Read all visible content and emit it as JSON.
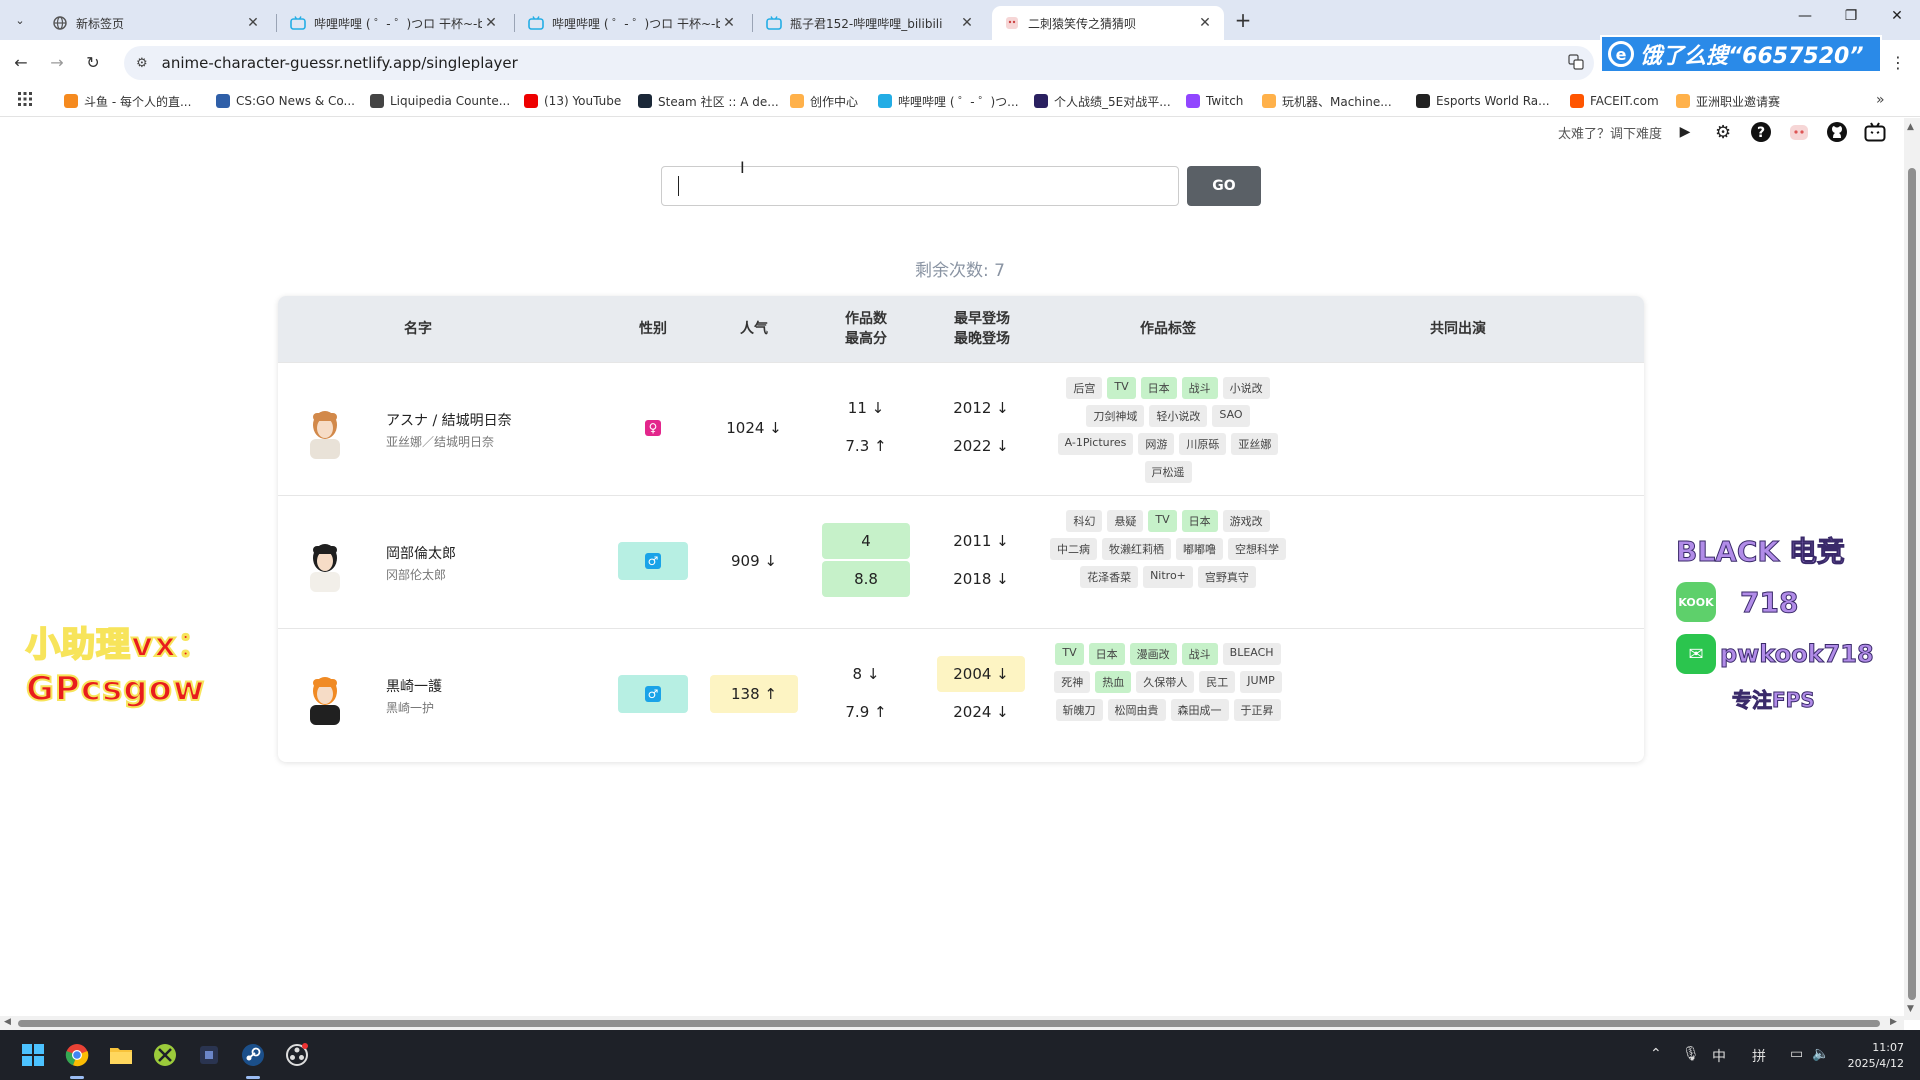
{
  "browser": {
    "tabs": [
      {
        "title": "新标签页",
        "active": false
      },
      {
        "title": "哔哩哔哩 ( ゜- ゜)つロ 干杯~-bili",
        "active": false
      },
      {
        "title": "哔哩哔哩 ( ゜- ゜)つロ 干杯~-bili",
        "active": false
      },
      {
        "title": "瓶子君152-哔哩哔哩_bilibili",
        "active": false
      },
      {
        "title": "二刺猿笑传之猜猜呗",
        "active": true
      }
    ],
    "url": "anime-character-guessr.netlify.app/singleplayer",
    "promo_text": "饿了么搜“6657520”",
    "bookmarks": [
      {
        "label": "斗鱼 - 每个人的直...",
        "color": "#f58a1f"
      },
      {
        "label": "CS:GO News & Co...",
        "color": "#2f5fa8"
      },
      {
        "label": "Liquipedia Counte...",
        "color": "#444"
      },
      {
        "label": "(13) YouTube",
        "color": "#e00"
      },
      {
        "label": "Steam 社区 :: A de...",
        "color": "#1b2838"
      },
      {
        "label": "创作中心",
        "color": "#ffb14a"
      },
      {
        "label": "哔哩哔哩 ( ゜- ゜)つ...",
        "color": "#23ade5"
      },
      {
        "label": "个人战绩_5E对战平...",
        "color": "#2a2060"
      },
      {
        "label": "Twitch",
        "color": "#9146ff"
      },
      {
        "label": "玩机器、Machine...",
        "color": "#ffb14a"
      },
      {
        "label": "Esports World Ra...",
        "color": "#222"
      },
      {
        "label": "FACEIT.com",
        "color": "#ff5500"
      },
      {
        "label": "亚洲职业邀请赛",
        "color": "#ffb14a"
      }
    ]
  },
  "game": {
    "difficulty_hint": "太难了？调下难度",
    "input_placeholder": "",
    "go_label": "GO",
    "remaining_label": "剩余次数: 7",
    "headers": {
      "name": "名字",
      "gender": "性别",
      "popularity": "人气",
      "works_count": "作品数",
      "highest_score": "最高分",
      "earliest": "最早登场",
      "latest": "最晚登场",
      "tags": "作品标签",
      "shared": "共同出演"
    },
    "rows": [
      {
        "name": "アスナ / 結城明日奈",
        "name_cn": "亚丝娜／结城明日奈",
        "gender": "female",
        "gender_match": false,
        "popularity": "1024 ↓",
        "popularity_hl": "",
        "works": "11 ↓",
        "works_hl": "",
        "score": "7.3 ↑",
        "score_hl": "",
        "earliest": "2012 ↓",
        "earliest_hl": "",
        "latest": "2022 ↓",
        "latest_hl": "",
        "tags": [
          {
            "t": "后宫",
            "m": false
          },
          {
            "t": "TV",
            "m": true
          },
          {
            "t": "日本",
            "m": true
          },
          {
            "t": "战斗",
            "m": true
          },
          {
            "t": "小说改",
            "m": false
          },
          {
            "t": "刀剑神域",
            "m": false
          },
          {
            "t": "轻小说改",
            "m": false
          },
          {
            "t": "SAO",
            "m": false
          },
          {
            "t": "A-1Pictures",
            "m": false
          },
          {
            "t": "网游",
            "m": false
          },
          {
            "t": "川原砾",
            "m": false
          },
          {
            "t": "亚丝娜",
            "m": false
          },
          {
            "t": "戸松遥",
            "m": false
          }
        ]
      },
      {
        "name": "岡部倫太郎",
        "name_cn": "冈部伦太郎",
        "gender": "male",
        "gender_match": true,
        "popularity": "909 ↓",
        "popularity_hl": "",
        "works": "4",
        "works_hl": "green",
        "score": "8.8",
        "score_hl": "green",
        "earliest": "2011 ↓",
        "earliest_hl": "",
        "latest": "2018 ↓",
        "latest_hl": "",
        "tags": [
          {
            "t": "科幻",
            "m": false
          },
          {
            "t": "悬疑",
            "m": false
          },
          {
            "t": "TV",
            "m": true
          },
          {
            "t": "日本",
            "m": true
          },
          {
            "t": "游戏改",
            "m": false
          },
          {
            "t": "中二病",
            "m": false
          },
          {
            "t": "牧濑红莉栖",
            "m": false
          },
          {
            "t": "嘟嘟噜",
            "m": false
          },
          {
            "t": "空想科学",
            "m": false
          },
          {
            "t": "花泽香菜",
            "m": false
          },
          {
            "t": "Nitro+",
            "m": false
          },
          {
            "t": "宫野真守",
            "m": false
          }
        ]
      },
      {
        "name": "黒崎一護",
        "name_cn": "黑崎一护",
        "gender": "male",
        "gender_match": true,
        "popularity": "138 ↑",
        "popularity_hl": "yellow",
        "works": "8 ↓",
        "works_hl": "",
        "score": "7.9 ↑",
        "score_hl": "",
        "earliest": "2004 ↓",
        "earliest_hl": "yellow",
        "latest": "2024 ↓",
        "latest_hl": "",
        "tags": [
          {
            "t": "TV",
            "m": true
          },
          {
            "t": "日本",
            "m": true
          },
          {
            "t": "漫画改",
            "m": true
          },
          {
            "t": "战斗",
            "m": true
          },
          {
            "t": "BLEACH",
            "m": false
          },
          {
            "t": "死神",
            "m": false
          },
          {
            "t": "热血",
            "m": true
          },
          {
            "t": "久保带人",
            "m": false
          },
          {
            "t": "民工",
            "m": false
          },
          {
            "t": "JUMP",
            "m": false
          },
          {
            "t": "斩魄刀",
            "m": false
          },
          {
            "t": "松岡由貴",
            "m": false
          },
          {
            "t": "森田成一",
            "m": false
          },
          {
            "t": "于正昇",
            "m": false
          }
        ]
      }
    ]
  },
  "overlays": {
    "left_line1": "小助理vx：",
    "left_line2": "GPcsgow",
    "right_title": "BLACK 电竞",
    "kook_badge": "KOOK",
    "kook_value": "718",
    "wechat_value": "pwkook718",
    "right_tagline": "专注FPS"
  },
  "taskbar": {
    "ime1": "中",
    "ime2": "拼",
    "time": "11:07",
    "date": "2025/4/12"
  }
}
